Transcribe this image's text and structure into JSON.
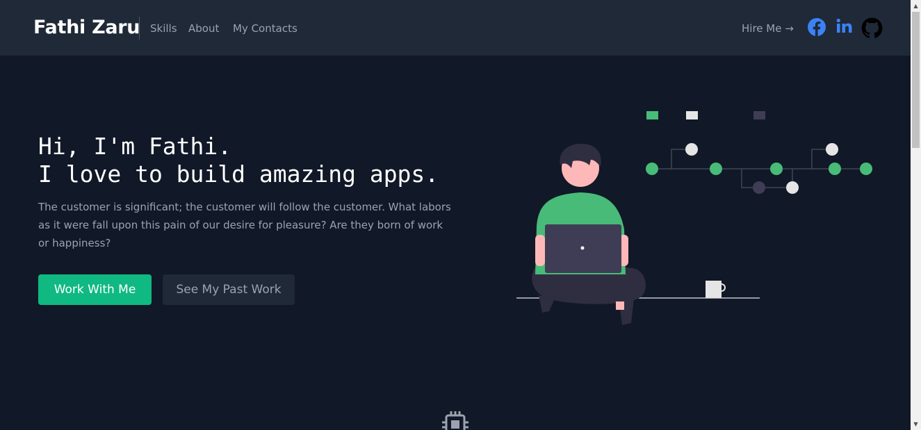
{
  "header": {
    "brand": "Fathi Zaru",
    "nav": [
      "Skills",
      "About",
      "My Contacts"
    ],
    "hire": "Hire Me →",
    "social_icons": [
      "facebook-icon",
      "linkedin-icon",
      "github-icon"
    ]
  },
  "hero": {
    "title": "Hi, I'm Fathi.\nI love to build amazing apps.",
    "description": "The customer is significant; the customer will follow the customer. What labors as it were fall upon this pain of our desire for pleasure? Are they born of work or happiness?",
    "primary_button": "Work With Me",
    "secondary_button": "See My Past Work"
  },
  "colors": {
    "background": "#111827",
    "navbar": "#1f2937",
    "accent": "#10b981",
    "illustration_green": "#48bb78",
    "facebook": "#3b82f6",
    "linkedin": "#3b82f6"
  },
  "icons": {
    "section_icon": "chip-icon",
    "scroll_up": "▲",
    "scroll_down": "▼"
  }
}
